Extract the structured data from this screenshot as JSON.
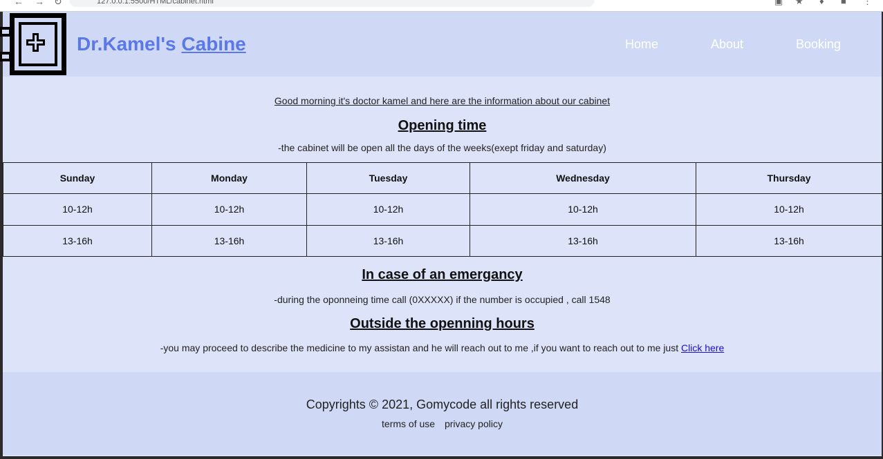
{
  "browser": {
    "url": "127.0.0.1:5500/HTML/cabinet.html"
  },
  "header": {
    "brand_prefix": "Dr.Kamel's",
    "brand_link": "Cabine",
    "nav": {
      "home": "Home",
      "about": "About",
      "booking": "Booking"
    },
    "brand_color": "#5a78e6",
    "background": "#cfd9f5"
  },
  "intro": "Good morning it's doctor kamel and here are the information about our cabinet",
  "opening": {
    "heading": "Opening time",
    "text": "-the cabinet will be open all the days of the weeks(exept friday and saturday)"
  },
  "schedule": {
    "days": [
      "Sunday",
      "Monday",
      "Tuesday",
      "Wednesday",
      "Thursday"
    ],
    "morning": [
      "10-12h",
      "10-12h",
      "10-12h",
      "10-12h",
      "10-12h"
    ],
    "afternoon": [
      "13-16h",
      "13-16h",
      "13-16h",
      "13-16h",
      "13-16h"
    ]
  },
  "emergency": {
    "heading": "In case of an emergancy",
    "text": "-during the oponneing time call (0XXXXX) if the number is occupied , call 1548"
  },
  "outside": {
    "heading": "Outside the openning hours",
    "text": "-you may proceed to describe the medicine to my assistan and he will reach out to me ,if you want to reach out to me just ",
    "link": "Click here"
  },
  "footer": {
    "copyright": "Copyrights © 2021, Gomycode all rights reserved",
    "terms": "terms of use",
    "privacy": "privacy policy"
  },
  "icons": {
    "logo": "medical-cabinet-icon"
  },
  "colors": {
    "page_background": "#dde3f8",
    "link": "#1a0dcc"
  }
}
